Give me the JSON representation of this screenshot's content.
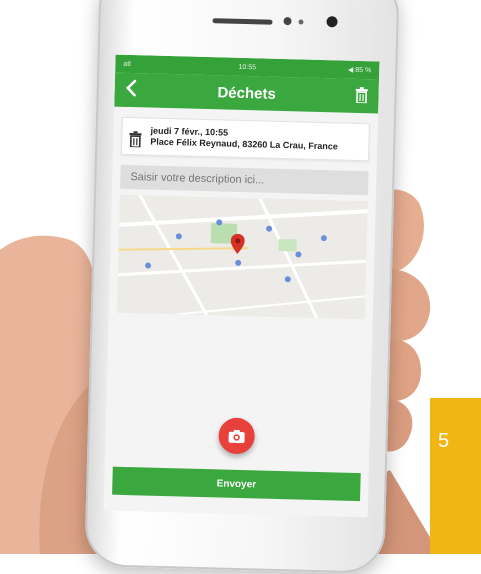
{
  "status_bar": {
    "carrier": "atl",
    "wifi": "⌔",
    "time": "10:55",
    "battery": "◀ 85 %"
  },
  "app_bar": {
    "back_icon": "chevron-left-icon",
    "title": "Déchets",
    "trash_icon": "trash-icon"
  },
  "report": {
    "date": "jeudi 7 févr., 10:55",
    "address": "Place Félix Reynaud, 83260 La Crau, France"
  },
  "description": {
    "placeholder": "Saisir votre description ici..."
  },
  "map": {
    "marker_icon": "map-pin-icon"
  },
  "camera_button": {
    "icon": "add-photo-icon"
  },
  "send_button": {
    "label": "Envoyer"
  },
  "page_corner": {
    "number": "5"
  },
  "colors": {
    "app_green": "#3aa83e",
    "camera_red": "#e8403a",
    "corner_yellow": "#f2b614"
  }
}
